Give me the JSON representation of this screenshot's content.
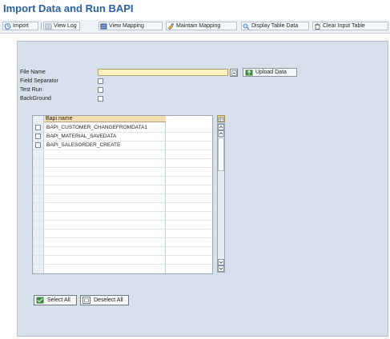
{
  "title": "Import Data and Run BAPI",
  "toolbar": {
    "buttons": [
      {
        "label": "Import",
        "icon": "clock-icon"
      },
      {
        "label": "View Log",
        "icon": "log-icon"
      },
      {
        "label": "View Mapping",
        "icon": "mapping-icon"
      },
      {
        "label": "Maintain Mapping",
        "icon": "maintain-icon"
      },
      {
        "label": "Display Table Data",
        "icon": "table-icon"
      },
      {
        "label": "Clear Input Table",
        "icon": "trash-icon"
      }
    ]
  },
  "form": {
    "file_name_label": "File Name",
    "file_name_value": "",
    "field_separator_label": "Field Separator",
    "test_run_label": "Test Run",
    "background_label": "BackGround",
    "upload_button_label": "Upload Data"
  },
  "table": {
    "header": "Bapi name",
    "rows": [
      "BAPI_CUSTOMER_CHANGEFROMDATA1",
      "BAPI_MATERIAL_SAVEDATA",
      "BAPI_SALESORDER_CREATE"
    ]
  },
  "buttons": {
    "select_all": "Select All",
    "deselect_all": "Deselect All"
  },
  "colors": {
    "title": "#2b5f9e",
    "panel_bg": "#d8e0ec",
    "input_required_bg": "#fbf2c0",
    "table_header_bg": "#f3deb0"
  }
}
